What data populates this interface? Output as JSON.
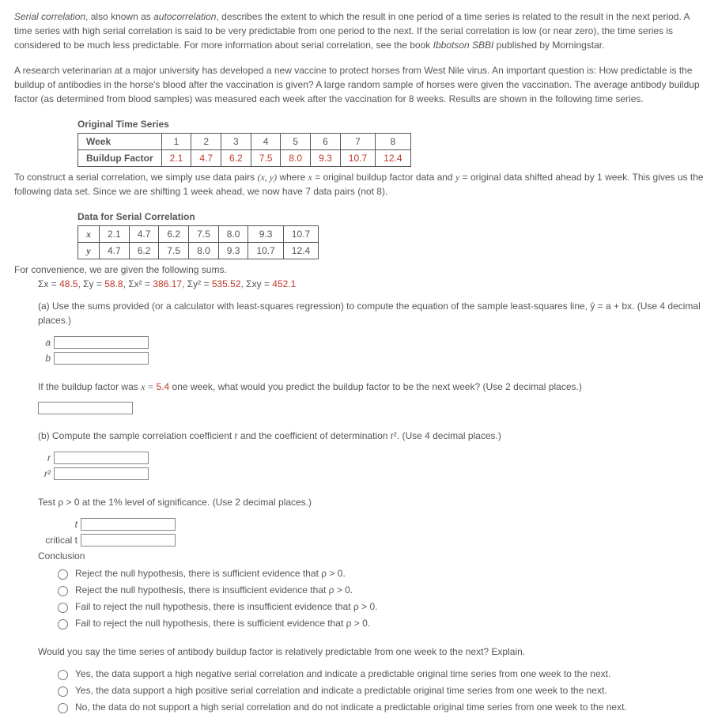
{
  "intro": {
    "p1_part1": "Serial correlation",
    "p1_part2": ", also known as ",
    "p1_part3": "autocorrelation",
    "p1_part4": ", describes the extent to which the result in one period of a time series is related to the result in the next period. A time series with high serial correlation is said to be very predictable from one period to the next. If the serial correlation is low (or near zero), the time series is considered to be much less predictable. For more information about serial correlation, see the book ",
    "p1_part5": "Ibbotson SBBI",
    "p1_part6": " published by Morningstar.",
    "p2": "A research veterinarian at a major university has developed a new vaccine to protect horses from West Nile virus. An important question is: How predictable is the buildup of antibodies in the horse's blood after the vaccination is given? A large random sample of horses were given the vaccination. The average antibody buildup factor (as determined from blood samples) was measured each week after the vaccination for 8 weeks. Results are shown in the following time series."
  },
  "table1": {
    "title": "Original Time Series",
    "row1_header": "Week",
    "row2_header": "Buildup Factor",
    "weeks": [
      "1",
      "2",
      "3",
      "4",
      "5",
      "6",
      "7",
      "8"
    ],
    "values": [
      "2.1",
      "4.7",
      "6.2",
      "7.5",
      "8.0",
      "9.3",
      "10.7",
      "12.4"
    ]
  },
  "construct": {
    "p1_a": "To construct a serial correlation, we simply use data pairs ",
    "p1_b": "(x, y)",
    "p1_c": " where ",
    "p1_d": "x",
    "p1_e": " = original buildup factor data and ",
    "p1_f": "y",
    "p1_g": " = original data shifted ahead by 1 week. This gives us the following data set. Since we are shifting 1 week ahead, we now have 7 data pairs (not 8)."
  },
  "table2": {
    "title": "Data for Serial Correlation",
    "x_label": "x",
    "y_label": "y",
    "x_values": [
      "2.1",
      "4.7",
      "6.2",
      "7.5",
      "8.0",
      "9.3",
      "10.7"
    ],
    "y_values": [
      "4.7",
      "6.2",
      "7.5",
      "8.0",
      "9.3",
      "10.7",
      "12.4"
    ]
  },
  "sums": {
    "intro": "For convenience, we are given the following sums.",
    "sx_label": "Σx = ",
    "sx_val": "48.5",
    "sy_label": ",  Σy = ",
    "sy_val": "58.8",
    "sx2_label": ",  Σx² = ",
    "sx2_val": "386.17",
    "sy2_label": ",  Σy² = ",
    "sy2_val": "535.52",
    "sxy_label": ",  Σxy = ",
    "sxy_val": "452.1"
  },
  "part_a": {
    "q": "(a) Use the sums provided (or a calculator with least-squares regression) to compute the equation of the sample least-squares line, ŷ = a + bx.  (Use 4 decimal places.)",
    "label_a": "a",
    "label_b": "b",
    "followup_a": "If the buildup factor was ",
    "followup_x": "x = ",
    "followup_val": "5.4",
    "followup_b": " one week, what would you predict the buildup factor to be the next week? (Use 2 decimal places.)"
  },
  "part_b": {
    "q": "(b) Compute the sample correlation coefficient r and the coefficient of determination r².  (Use 4 decimal places.)",
    "label_r": "r",
    "label_r2": "r²"
  },
  "test": {
    "q": "Test  ρ > 0  at the 1% level of significance. (Use 2 decimal places.)",
    "label_t": "t",
    "label_crit": "critical t",
    "conclusion": "Conclusion",
    "opt1": "Reject the null hypothesis, there is sufficient evidence that ρ > 0.",
    "opt2": "Reject the null hypothesis, there is insufficient evidence that ρ > 0.",
    "opt3": "Fail to reject the null hypothesis, there is insufficient evidence that ρ > 0.",
    "opt4": "Fail to reject the null hypothesis, there is sufficient evidence that ρ > 0."
  },
  "final": {
    "q": "Would you say the time series of antibody buildup factor is relatively predictable from one week to the next? Explain.",
    "opt1": "Yes, the data support a high negative serial correlation and indicate a predictable original time series from one week to the next.",
    "opt2": "Yes, the data support a high positive serial correlation and indicate a predictable original time series from one week to the next.",
    "opt3": "No, the data do not support a high serial correlation and do not indicate a predictable original time series from one week to the next."
  }
}
